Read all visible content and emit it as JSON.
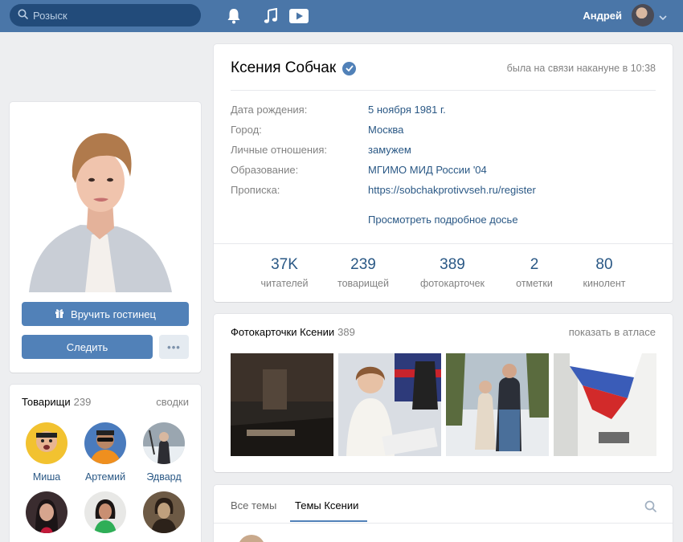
{
  "header": {
    "search_placeholder": "Розыск",
    "user_name": "Андрей",
    "icons": [
      "search-icon",
      "bell-icon",
      "music-icon",
      "video-icon",
      "chevron-down-icon"
    ]
  },
  "profile": {
    "name": "Ксения Собчак",
    "last_seen": "была на связи накануне в 10:38",
    "info": [
      {
        "label": "Дата рождения:",
        "value": "5 ноября 1981 г."
      },
      {
        "label": "Город:",
        "value": "Москва"
      },
      {
        "label": "Личные отношения:",
        "value": "замужем"
      },
      {
        "label": "Образование:",
        "value": "МГИМО МИД России '04"
      },
      {
        "label": "Прописка:",
        "value": "https://sobchakprotivvseh.ru/register"
      }
    ],
    "dossier_link": "Просмотреть подробное досье",
    "stats": [
      {
        "num": "37K",
        "label": "читателей"
      },
      {
        "num": "239",
        "label": "товарищей"
      },
      {
        "num": "389",
        "label": "фотокарточек"
      },
      {
        "num": "2",
        "label": "отметки"
      },
      {
        "num": "80",
        "label": "кинолент"
      }
    ]
  },
  "actions": {
    "gift_label": "Вручить гостинец",
    "follow_label": "Следить",
    "more_label": "•••"
  },
  "friends": {
    "title": "Товарищи",
    "count": "239",
    "link": "сводки",
    "items": [
      {
        "name": "Миша"
      },
      {
        "name": "Артемий"
      },
      {
        "name": "Эдвард"
      },
      {
        "name": ""
      },
      {
        "name": ""
      },
      {
        "name": ""
      }
    ]
  },
  "photos": {
    "title": "Фотокарточки Ксении",
    "count": "389",
    "link": "показать в атласе"
  },
  "wall": {
    "tab_all": "Все темы",
    "tab_own": "Темы Ксении"
  },
  "colors": {
    "header_bg": "#4a76a8",
    "accent": "#5181b8",
    "link": "#2a5885",
    "page_bg": "#edeef0"
  }
}
